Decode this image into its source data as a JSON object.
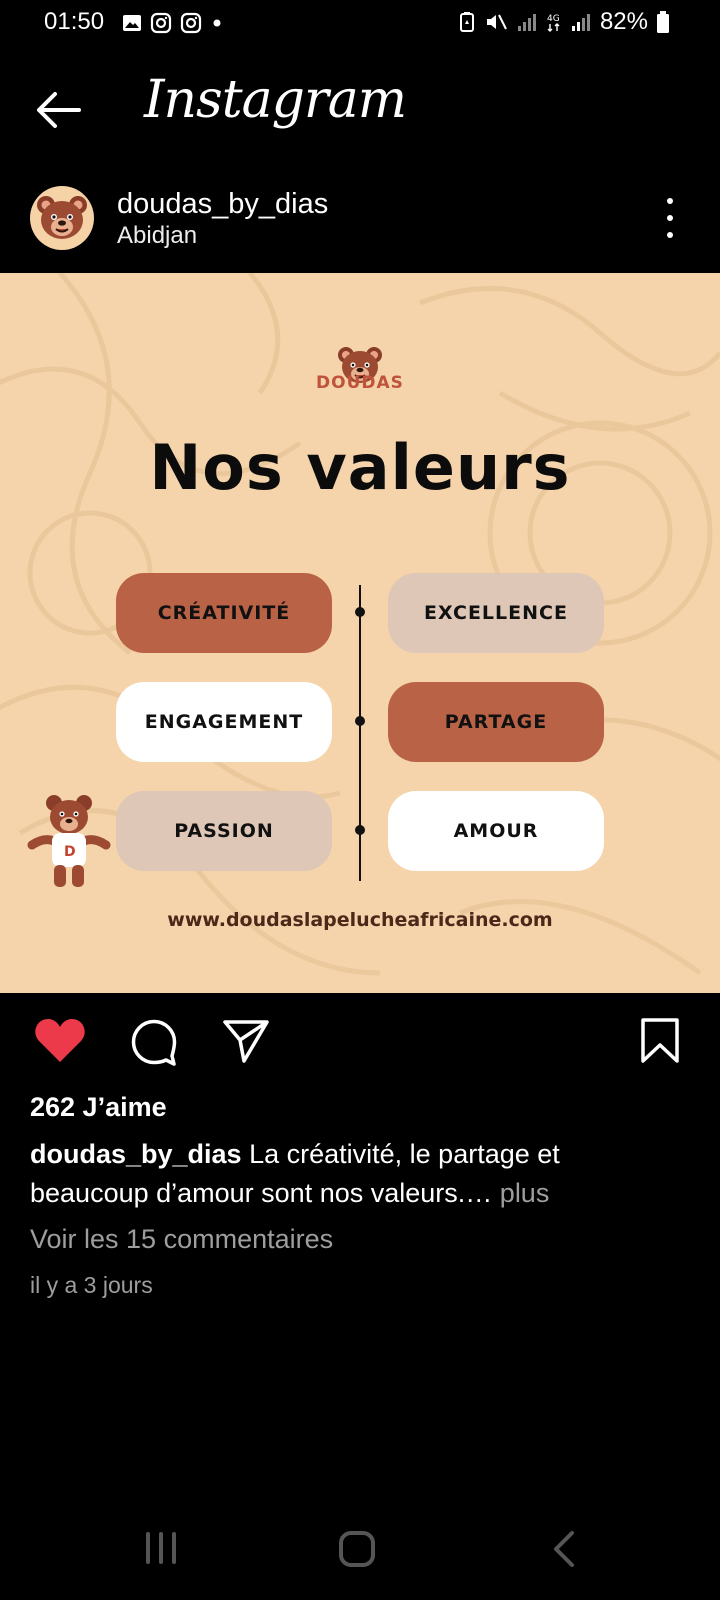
{
  "status_bar": {
    "time": "01:50",
    "battery": "82%"
  },
  "app_bar": {
    "title": "Instagram"
  },
  "post": {
    "username": "doudas_by_dias",
    "location": "Abidjan",
    "image": {
      "brand": "DOUDAS",
      "headline": "Nos valeurs",
      "values_left": [
        "CRÉATIVITÉ",
        "ENGAGEMENT",
        "PASSION"
      ],
      "values_right": [
        "EXCELLENCE",
        "PARTAGE",
        "AMOUR"
      ],
      "website": "www.doudaslapelucheafricaine.com"
    },
    "likes": "262 J’aime",
    "caption_user": "doudas_by_dias",
    "caption_text": "La créativité, le partage et beaucoup d’amour sont nos valeurs.…",
    "caption_more": "plus",
    "comments_link": "Voir les 15 commentaires",
    "timestamp": "il y a 3 jours"
  },
  "colors": {
    "heart": "#ed3a4a",
    "pill_brown": "#ba6246",
    "pill_grey": "#dec7b6",
    "image_bg": "#f5d4ab"
  }
}
